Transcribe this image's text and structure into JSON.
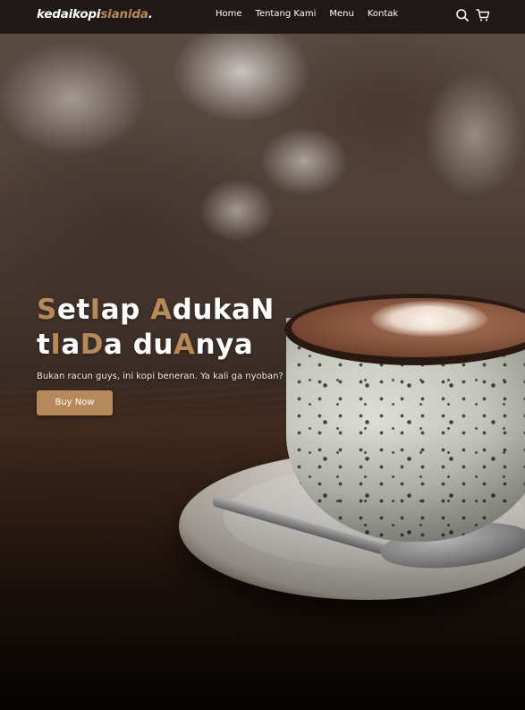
{
  "brand": {
    "part1": "kedaikopi",
    "part2": "sianida",
    "part3": ".",
    "accent_color": "#b6895b"
  },
  "nav": {
    "links": [
      {
        "label": "Home"
      },
      {
        "label": "Tentang Kami"
      },
      {
        "label": "Menu"
      },
      {
        "label": "Kontak"
      }
    ],
    "icons": [
      "search-icon",
      "shopping-cart-icon"
    ]
  },
  "hero": {
    "headline_line1": [
      {
        "text": "S",
        "accent": true
      },
      {
        "text": "et",
        "accent": false
      },
      {
        "text": "I",
        "accent": true
      },
      {
        "text": "ap ",
        "accent": false
      },
      {
        "text": "A",
        "accent": true
      },
      {
        "text": "dukaN",
        "accent": false
      }
    ],
    "headline_line2": [
      {
        "text": "t",
        "accent": false
      },
      {
        "text": "I",
        "accent": true
      },
      {
        "text": "a",
        "accent": false
      },
      {
        "text": "D",
        "accent": true
      },
      {
        "text": "a du",
        "accent": false
      },
      {
        "text": "A",
        "accent": true
      },
      {
        "text": "nya",
        "accent": false
      }
    ],
    "subtitle": "Bukan racun guys, ini kopi beneran. Ya kali ga nyoban?",
    "cta_label": "Buy Now"
  }
}
